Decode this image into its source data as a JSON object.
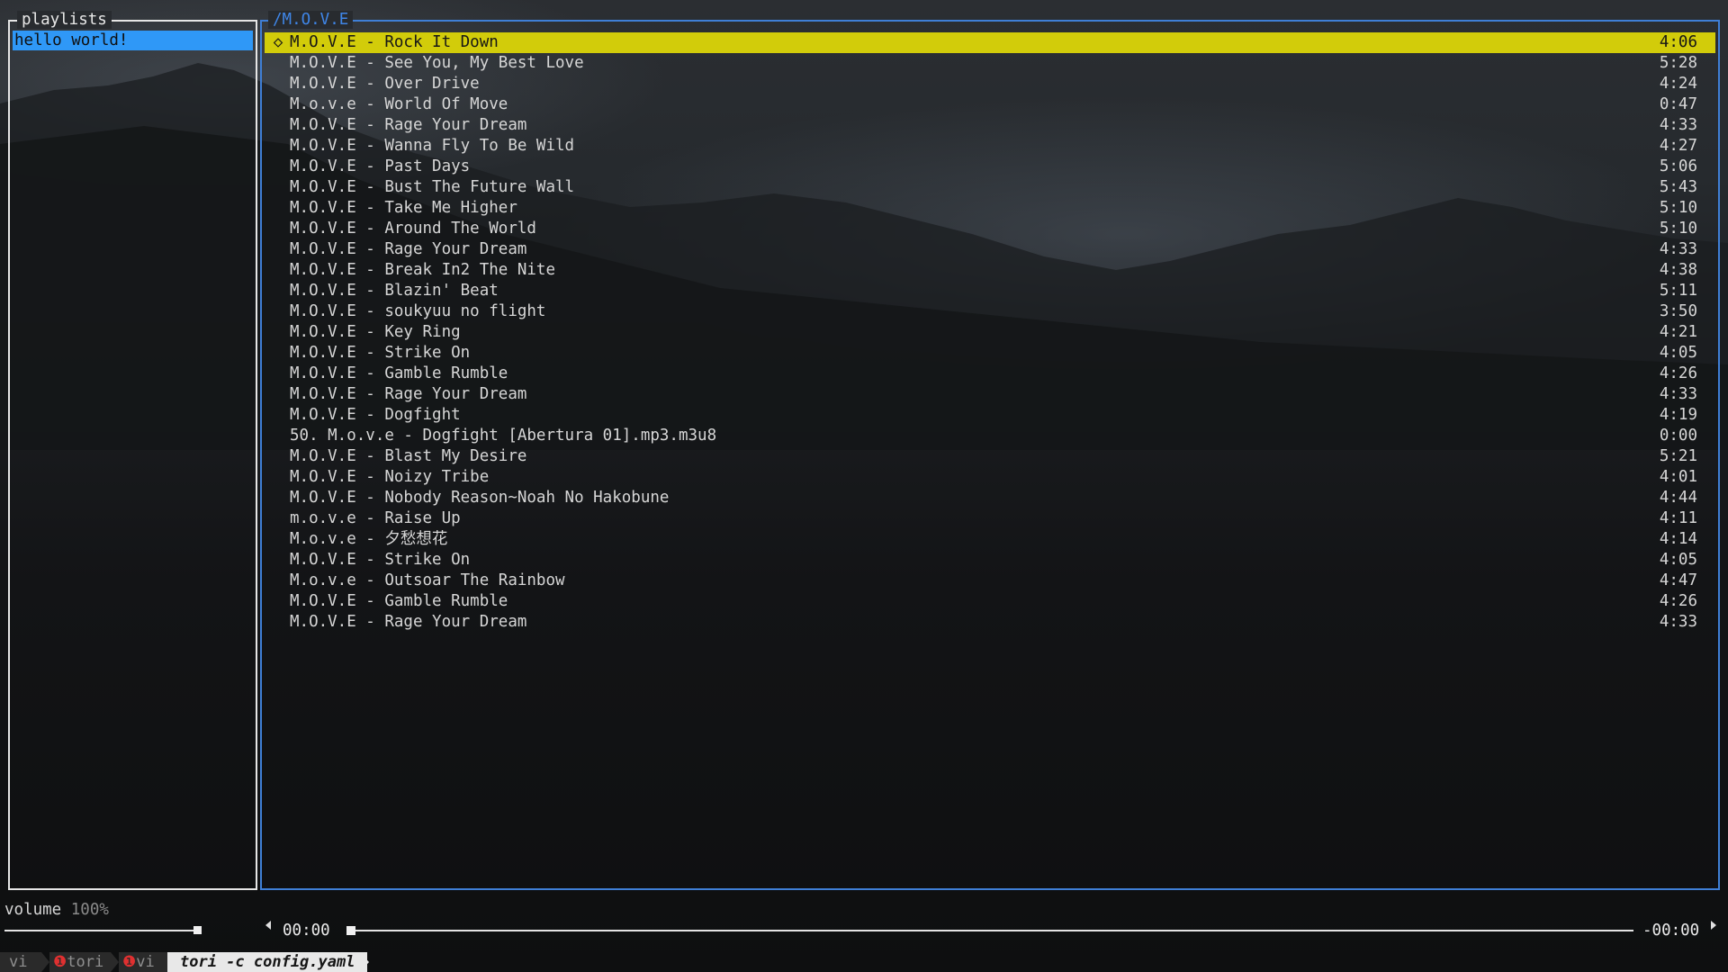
{
  "playlists_panel": {
    "title": "playlists",
    "items": [
      {
        "label": "hello world!",
        "selected": true
      }
    ]
  },
  "songs_panel": {
    "title": "/M.O.V.E",
    "current_marker": "◇",
    "songs": [
      {
        "title": "M.O.V.E - Rock It Down",
        "duration": "4:06",
        "current": true
      },
      {
        "title": "M.O.V.E - See You, My Best Love",
        "duration": "5:28"
      },
      {
        "title": "M.O.V.E - Over Drive",
        "duration": "4:24"
      },
      {
        "title": "M.o.v.e - World Of Move",
        "duration": "0:47"
      },
      {
        "title": "M.O.V.E - Rage Your Dream",
        "duration": "4:33"
      },
      {
        "title": "M.O.V.E - Wanna Fly To Be Wild",
        "duration": "4:27"
      },
      {
        "title": "M.O.V.E - Past Days",
        "duration": "5:06"
      },
      {
        "title": "M.O.V.E - Bust The Future Wall",
        "duration": "5:43"
      },
      {
        "title": "M.O.V.E - Take Me Higher",
        "duration": "5:10"
      },
      {
        "title": "M.O.V.E - Around The World",
        "duration": "5:10"
      },
      {
        "title": "M.O.V.E - Rage Your Dream",
        "duration": "4:33"
      },
      {
        "title": "M.O.V.E - Break In2 The Nite",
        "duration": "4:38"
      },
      {
        "title": "M.O.V.E - Blazin' Beat",
        "duration": "5:11"
      },
      {
        "title": "M.O.V.E - soukyuu no flight",
        "duration": "3:50"
      },
      {
        "title": "M.O.V.E - Key Ring",
        "duration": "4:21"
      },
      {
        "title": "M.O.V.E - Strike On",
        "duration": "4:05"
      },
      {
        "title": "M.O.V.E - Gamble Rumble",
        "duration": "4:26"
      },
      {
        "title": "M.O.V.E - Rage Your Dream",
        "duration": "4:33"
      },
      {
        "title": "M.O.V.E - Dogfight",
        "duration": "4:19"
      },
      {
        "title": "50. M.o.v.e - Dogfight [Abertura 01].mp3.m3u8",
        "duration": "0:00"
      },
      {
        "title": "M.O.V.E - Blast My Desire",
        "duration": "5:21"
      },
      {
        "title": "M.O.V.E - Noizy Tribe",
        "duration": "4:01"
      },
      {
        "title": "M.O.V.E - Nobody Reason~Noah No Hakobune",
        "duration": "4:44"
      },
      {
        "title": "m.o.v.e - Raise Up",
        "duration": "4:11"
      },
      {
        "title": "M.o.v.e - 夕愁想花",
        "duration": "4:14"
      },
      {
        "title": "M.O.V.E - Strike On",
        "duration": "4:05"
      },
      {
        "title": "M.o.v.e - Outsoar The Rainbow",
        "duration": "4:47"
      },
      {
        "title": "M.O.V.E - Gamble Rumble",
        "duration": "4:26"
      },
      {
        "title": "M.O.V.E - Rage Your Dream",
        "duration": "4:33"
      }
    ]
  },
  "player": {
    "volume_label": "volume",
    "volume_value": "100%",
    "volume_level": 1.0,
    "time_elapsed": "00:00",
    "time_remaining": "-00:00",
    "progress": 0.0
  },
  "status_bar": {
    "tabs": [
      "vi",
      "tori",
      "vi"
    ],
    "tab_indicators": [
      "",
      "❶",
      "❶"
    ],
    "active_command": "tori -c config.yaml"
  },
  "colors": {
    "accent": "#3f7fd6",
    "selection": "#2f98f7",
    "current_song": "#d2cc0a"
  },
  "icons": {
    "current_song_marker": "diamond-outline-icon",
    "prev": "triangle-left-icon",
    "next": "triangle-right-icon"
  }
}
